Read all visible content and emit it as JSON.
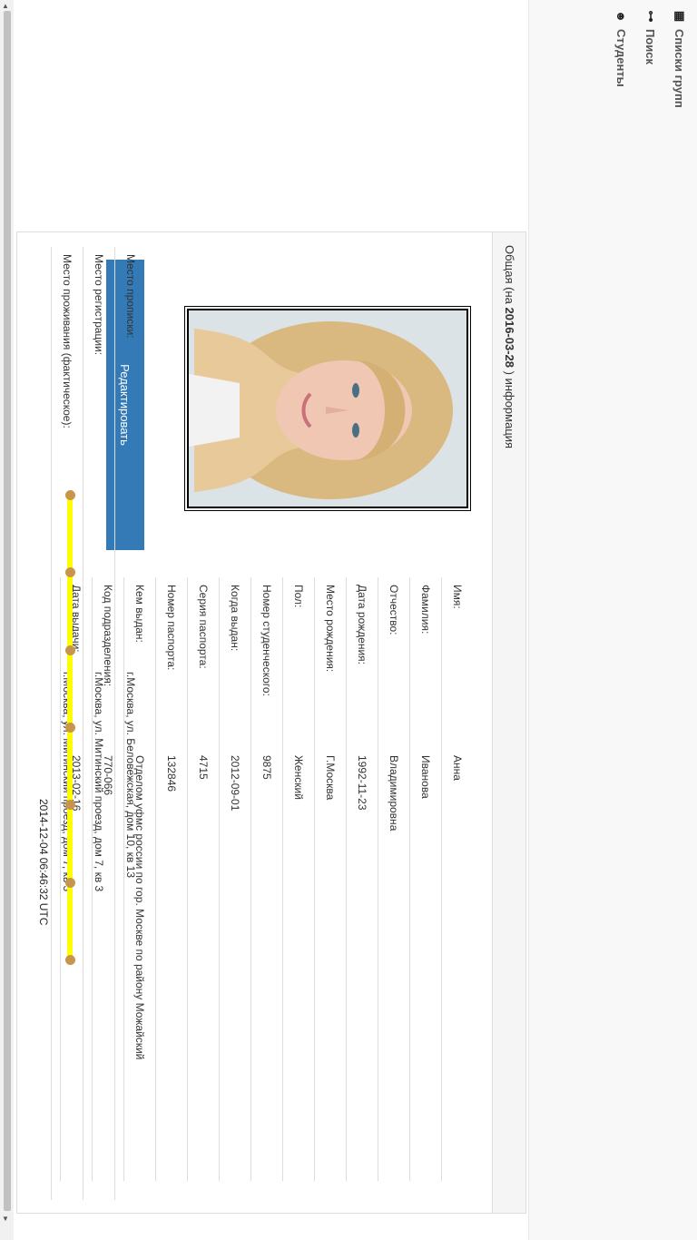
{
  "nav": {
    "groups": "Списки групп",
    "search": "Поиск",
    "students": "Студенты"
  },
  "heading": {
    "prefix": "Общая (на",
    "date": "2016-03-28",
    "suffix": ") информация"
  },
  "edit_label": "Редактировать",
  "fields": [
    {
      "label": "Имя:",
      "value": "Анна"
    },
    {
      "label": "Фамилия:",
      "value": "Иванова"
    },
    {
      "label": "Отчество:",
      "value": "Владимировна"
    },
    {
      "label": "Дата рождения:",
      "value": "1992-11-23"
    },
    {
      "label": "Место рождения:",
      "value": "Г.Москва"
    },
    {
      "label": "Пол:",
      "value": "Женский"
    },
    {
      "label": "Номер студенческого:",
      "value": "9875"
    },
    {
      "label": "Когда выдан:",
      "value": "2012-09-01"
    },
    {
      "label": "Серия паспорта:",
      "value": "4715"
    },
    {
      "label": "Номер паспорта:",
      "value": "132846"
    },
    {
      "label": "Кем выдан:",
      "value": "Отделом уфмс россии по гор. Москве по району Можайский"
    },
    {
      "label": "Код подразделения:",
      "value": "770-066"
    },
    {
      "label": "Дата выдачи:",
      "value": "2013-02-16"
    }
  ],
  "addresses": [
    {
      "label": "Место прописки:",
      "value": "г.Москва, ул. Беловежская, дом 10, кв 13"
    },
    {
      "label": "Место регистрации:",
      "value": "г.Москва, ул. Митинский проезд, дом 7, кв 3"
    },
    {
      "label": "Место проживания (фактическое):",
      "value": "г.Москва, ул. Митинский проезд, дом 7, кв 3"
    }
  ],
  "timestamp": "2014-12-04 06:46:32 UTC",
  "colors": {
    "button": "#337ab7",
    "timeline": "#ffff00",
    "dot": "#c8964a"
  }
}
